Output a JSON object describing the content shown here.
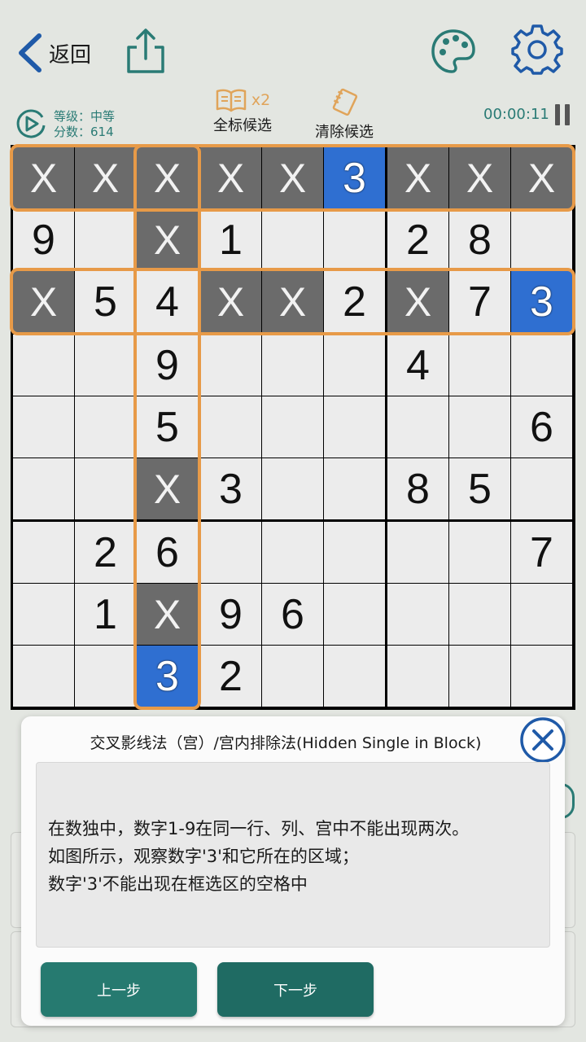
{
  "colors": {
    "accent": "#2a7b75",
    "frame": "#e79a48",
    "highlight": "#2f6fd1",
    "excluded": "#6b6b6b",
    "button": "#267a70"
  },
  "header": {
    "back_label": "返回",
    "share_icon": "share-icon",
    "palette_icon": "palette-icon",
    "settings_icon": "gear-icon"
  },
  "info": {
    "level": "等级：中等",
    "score": "分数：614",
    "mark_all_count": "x2",
    "mark_all_label": "全标候选",
    "clear_label": "清除候选",
    "timer": "00:00:11"
  },
  "board": {
    "rows": [
      [
        "X",
        "X",
        "X",
        "X",
        "X",
        "3",
        "X",
        "X",
        "X"
      ],
      [
        "9",
        "",
        "X",
        "1",
        "",
        "",
        "2",
        "8",
        ""
      ],
      [
        "X",
        "5",
        "4",
        "X",
        "X",
        "2",
        "X",
        "7",
        "3"
      ],
      [
        "",
        "",
        "9",
        "",
        "",
        "",
        "4",
        "",
        ""
      ],
      [
        "",
        "",
        "5",
        "",
        "",
        "",
        "",
        "",
        "6"
      ],
      [
        "",
        "",
        "X",
        "3",
        "",
        "",
        "8",
        "5",
        ""
      ],
      [
        "",
        "2",
        "6",
        "",
        "",
        "",
        "",
        "",
        "7"
      ],
      [
        "",
        "1",
        "X",
        "9",
        "6",
        "",
        "",
        "",
        ""
      ],
      [
        "",
        "",
        "3",
        "2",
        "",
        "",
        "",
        "",
        ""
      ]
    ],
    "highlighted": [
      [
        0,
        5
      ],
      [
        2,
        8
      ],
      [
        8,
        2
      ]
    ]
  },
  "dialog": {
    "title": "交叉影线法（宫）/宫内排除法(Hidden Single in Block)",
    "lines": [
      "在数独中，数字1-9在同一行、列、宫中不能出现两次。",
      "如图所示，观察数字'3'和它所在的区域；",
      "数字'3'不能出现在框选区的空格中"
    ],
    "prev_label": "上一步",
    "next_label": "下一步"
  }
}
